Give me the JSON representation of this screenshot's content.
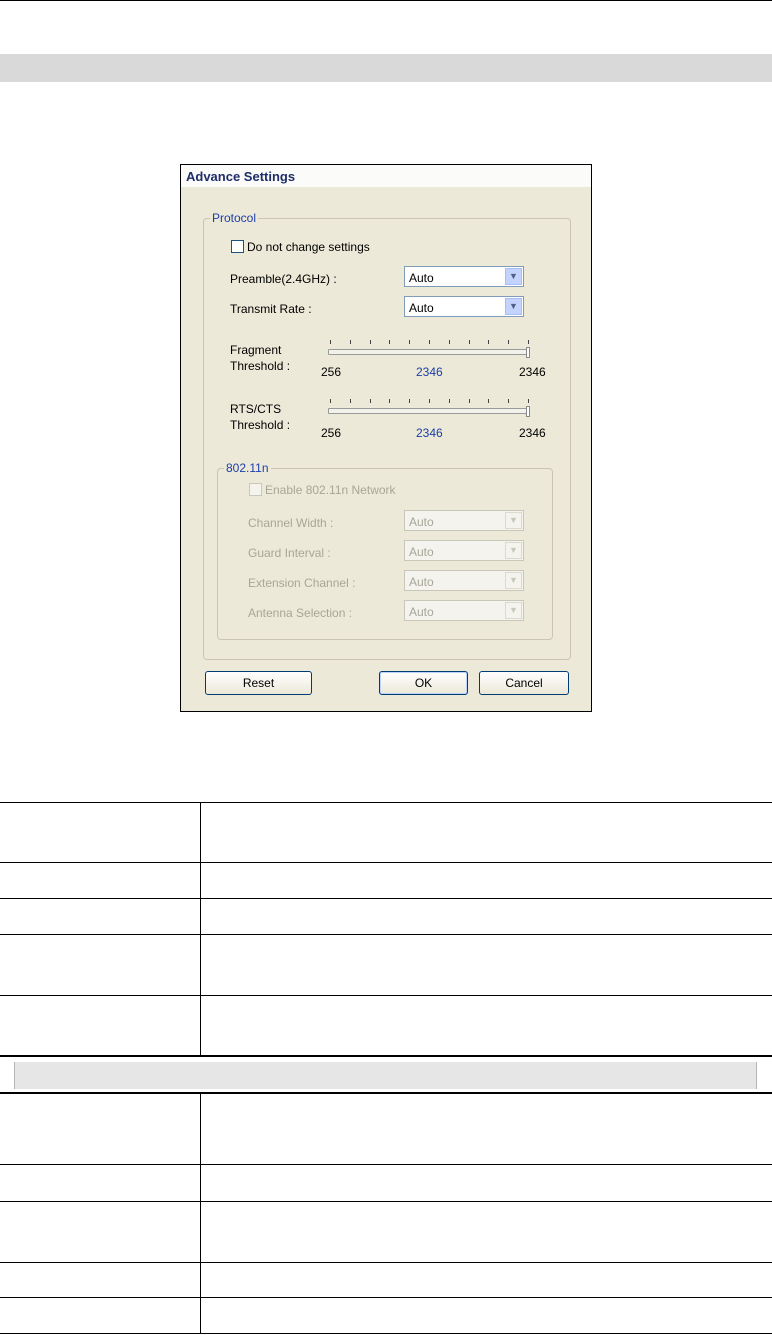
{
  "dialog": {
    "title": "Advance Settings",
    "protocol": {
      "legend": "Protocol",
      "dont_change_label": "Do not change settings",
      "preamble_label": "Preamble(2.4GHz) :",
      "preamble_value": "Auto",
      "transmit_label": "Transmit Rate :",
      "transmit_value": "Auto",
      "fragment": {
        "label1": "Fragment",
        "label2": "Threshold :",
        "min": "256",
        "current": "2346",
        "max": "2346",
        "level": 1.0
      },
      "rts": {
        "label1": "RTS/CTS",
        "label2": "Threshold :",
        "min": "256",
        "current": "2346",
        "max": "2346",
        "level": 1.0
      }
    },
    "n80211": {
      "legend": "802.11n",
      "enable_label": "Enable 802.11n Network",
      "channel_width_label": "Channel Width :",
      "channel_width_value": "Auto",
      "guard_label": "Guard Interval :",
      "guard_value": "Auto",
      "extension_label": "Extension Channel :",
      "extension_value": "Auto",
      "antenna_label": "Antenna Selection :",
      "antenna_value": "Auto"
    },
    "buttons": {
      "reset": "Reset",
      "ok": "OK",
      "cancel": "Cancel"
    }
  }
}
